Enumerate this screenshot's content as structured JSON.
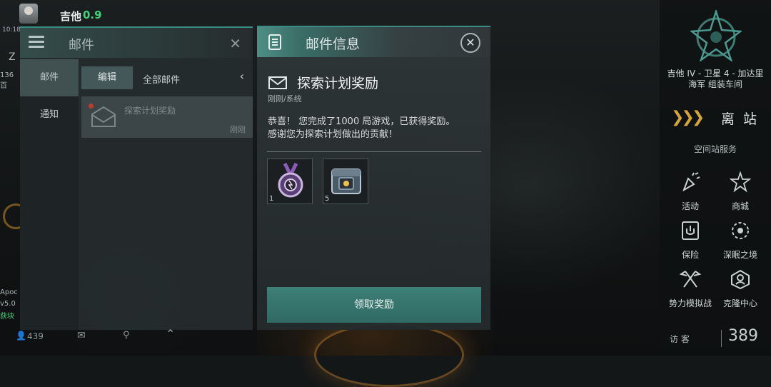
{
  "player": {
    "name": "吉他",
    "security": "0.9",
    "time": "10:18"
  },
  "left_edge": {
    "letter": "Z",
    "count_text": "136百",
    "apo_text": "Apoc",
    "version": "v5.0",
    "status": "获块"
  },
  "mail_panel": {
    "title": "邮件",
    "tabs": [
      {
        "label": "邮件"
      },
      {
        "label": "通知"
      }
    ],
    "edit_label": "编辑",
    "filter_label": "全部邮件",
    "items": [
      {
        "title": "探索计划奖励",
        "time": "刚刚"
      }
    ]
  },
  "bottom_bar": {
    "count": "439"
  },
  "dialog": {
    "title": "邮件信息",
    "subject": "探索计划奖励",
    "sender": "刚刚/系统",
    "body_line1": "恭喜！ 您完成了1000 局游戏，已获得奖励。",
    "body_line2": "感谢您为探索计划做出的贡献！",
    "rewards": [
      {
        "icon": "medal-icon",
        "qty": "1"
      },
      {
        "icon": "crate-icon",
        "qty": "5"
      }
    ],
    "claim_label": "领取奖励"
  },
  "right_panel": {
    "station_line1": "吉他 IV - 卫星 4 - 加达里",
    "station_line2": "海军 组装车间",
    "undock_label": "离 站",
    "services_title": "空间站服务",
    "services": [
      {
        "label": "活动",
        "icon": "party-icon"
      },
      {
        "label": "商城",
        "icon": "nes-star-icon"
      },
      {
        "label": "保险",
        "icon": "insurance-icon"
      },
      {
        "label": "深眠之境",
        "icon": "abyss-icon"
      },
      {
        "label": "势力模拟战",
        "icon": "crossed-flags-icon"
      },
      {
        "label": "克隆中心",
        "icon": "clone-icon"
      }
    ],
    "visitors_label": "访 客",
    "visitors_count": "389"
  },
  "colors": {
    "accent": "#3b8c84",
    "undock_arrows": "#d6a536",
    "security": "#3fd17b",
    "unread": "#c0392b"
  }
}
